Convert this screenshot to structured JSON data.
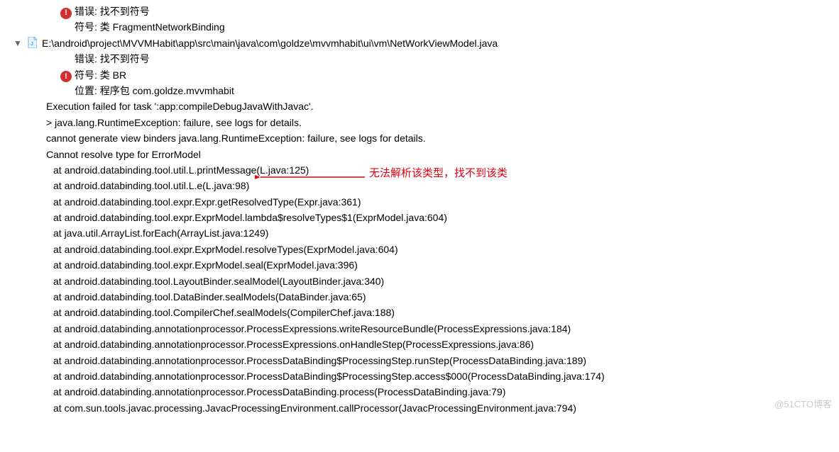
{
  "errors": {
    "err1_line1": "错误: 找不到符号",
    "err1_line2": "符号: 类 FragmentNetworkBinding",
    "file_path": "E:\\android\\project\\MVVMHabit\\app\\src\\main\\java\\com\\goldze\\mvvmhabit\\ui\\vm\\NetWorkViewModel.java",
    "err2_line1": "错误: 找不到符号",
    "err2_line2": "符号:   类 BR",
    "err2_line3": "位置: 程序包 com.goldze.mvvmhabit"
  },
  "execution": {
    "line1": "Execution failed for task ':app:compileDebugJavaWithJavac'.",
    "line2": "> java.lang.RuntimeException: failure, see logs for details.",
    "line3": "cannot generate view binders java.lang.RuntimeException: failure, see logs for details.",
    "line4": "Cannot resolve type for ErrorModel"
  },
  "annotation": "无法解析该类型，找不到该类",
  "stacktrace": [
    "at android.databinding.tool.util.L.printMessage(L.java:125)",
    "at android.databinding.tool.util.L.e(L.java:98)",
    "at android.databinding.tool.expr.Expr.getResolvedType(Expr.java:361)",
    "at android.databinding.tool.expr.ExprModel.lambda$resolveTypes$1(ExprModel.java:604)",
    "at java.util.ArrayList.forEach(ArrayList.java:1249)",
    "at android.databinding.tool.expr.ExprModel.resolveTypes(ExprModel.java:604)",
    "at android.databinding.tool.expr.ExprModel.seal(ExprModel.java:396)",
    "at android.databinding.tool.LayoutBinder.sealModel(LayoutBinder.java:340)",
    "at android.databinding.tool.DataBinder.sealModels(DataBinder.java:65)",
    "at android.databinding.tool.CompilerChef.sealModels(CompilerChef.java:188)",
    "at android.databinding.annotationprocessor.ProcessExpressions.writeResourceBundle(ProcessExpressions.java:184)",
    "at android.databinding.annotationprocessor.ProcessExpressions.onHandleStep(ProcessExpressions.java:86)",
    "at android.databinding.annotationprocessor.ProcessDataBinding$ProcessingStep.runStep(ProcessDataBinding.java:189)",
    "at android.databinding.annotationprocessor.ProcessDataBinding$ProcessingStep.access$000(ProcessDataBinding.java:174)",
    "at android.databinding.annotationprocessor.ProcessDataBinding.process(ProcessDataBinding.java:79)",
    "at com.sun.tools.javac.processing.JavacProcessingEnvironment.callProcessor(JavacProcessingEnvironment.java:794)"
  ],
  "watermark": "@51CTO博客"
}
